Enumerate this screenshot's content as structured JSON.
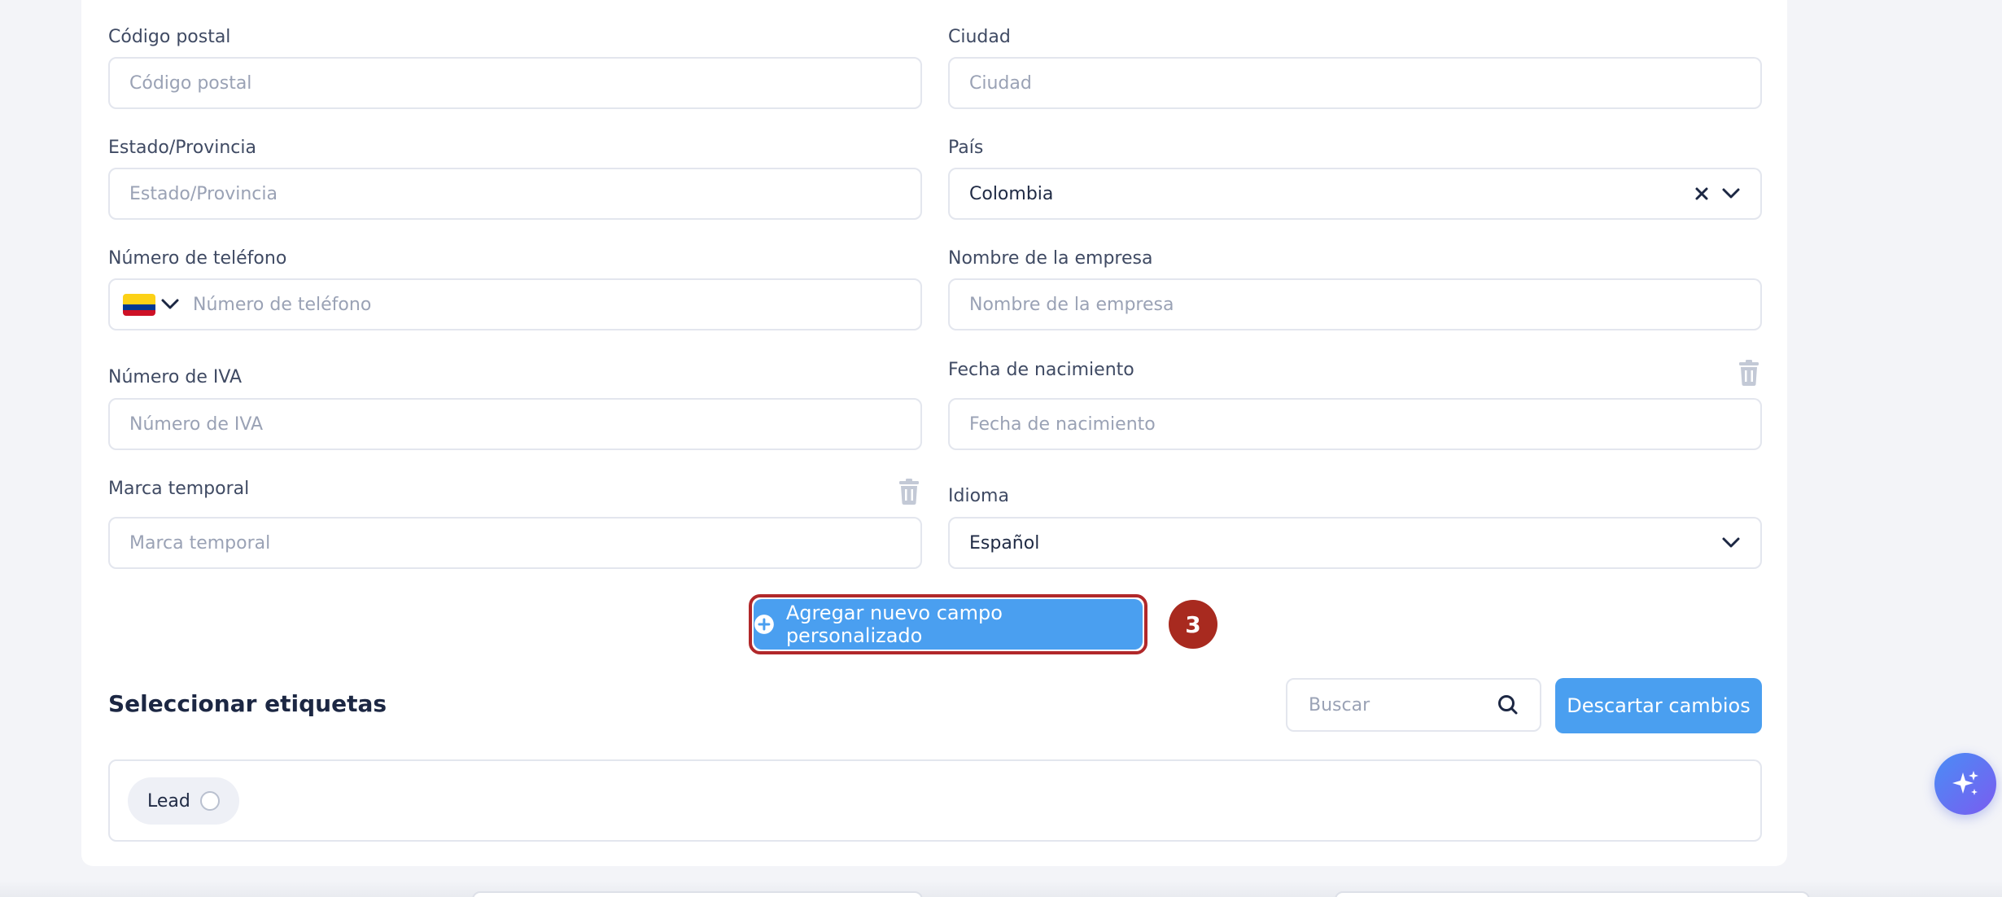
{
  "form": {
    "postal_code": {
      "label": "Código postal",
      "placeholder": "Código postal"
    },
    "city": {
      "label": "Ciudad",
      "placeholder": "Ciudad"
    },
    "state": {
      "label": "Estado/Provincia",
      "placeholder": "Estado/Provincia"
    },
    "country": {
      "label": "País",
      "value": "Colombia"
    },
    "phone": {
      "label": "Número de teléfono",
      "placeholder": "Número de teléfono",
      "flag_colors": [
        "#fcd116",
        "#003893",
        "#ce1126"
      ]
    },
    "company": {
      "label": "Nombre de la empresa",
      "placeholder": "Nombre de la empresa"
    },
    "vat": {
      "label": "Número de IVA",
      "placeholder": "Número de IVA"
    },
    "birth_date": {
      "label": "Fecha de nacimiento",
      "placeholder": "Fecha de nacimiento"
    },
    "timestamp": {
      "label": "Marca temporal",
      "placeholder": "Marca temporal"
    },
    "language": {
      "label": "Idioma",
      "value": "Español"
    }
  },
  "add_field_button": {
    "label": "Agregar nuevo campo personalizado"
  },
  "step_badge": "3",
  "tags": {
    "title": "Seleccionar etiquetas",
    "search_placeholder": "Buscar",
    "discard_label": "Descartar cambios",
    "items": [
      {
        "label": "Lead"
      }
    ]
  },
  "colors": {
    "accent": "#4a9ff0",
    "highlight_border": "#b1282a",
    "badge": "#a82a1f",
    "placeholder": "#9aa2b5"
  }
}
